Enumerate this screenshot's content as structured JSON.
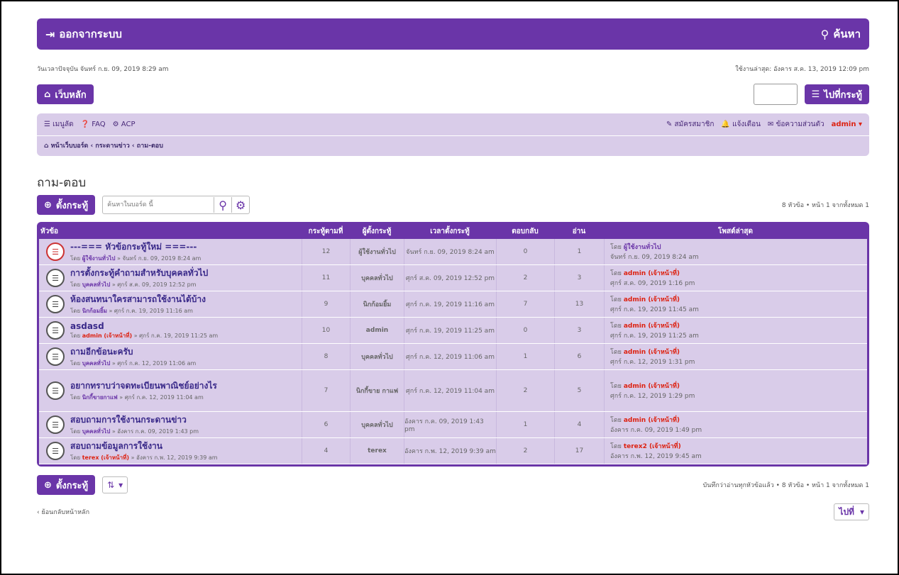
{
  "topbar": {
    "logout": "ออกจากระบบ",
    "search": "ค้นหา"
  },
  "timeline": {
    "current": "วันเวลาปัจจุบัน จันทร์ ก.ย. 09, 2019 8:29 am",
    "last_visit": "ใช้งานล่าสุด: อังคาร ส.ค. 13, 2019 12:09 pm"
  },
  "buttons": {
    "home": "เว็บหลัก",
    "goto_topic": "ไปที่กระทู้",
    "new_topic": "ตั้งกระทู้"
  },
  "navbar": {
    "left": [
      "เมนูลัด",
      "FAQ",
      "ACP"
    ],
    "right": [
      "สมัครสมาชิก",
      "แจ้งเตือน",
      "ข้อความส่วนตัว"
    ],
    "user": "admin",
    "breadcrumbs": [
      "หน้าเว็บบอร์ด",
      "กระดานข่าว",
      "ถาม-ตอบ"
    ]
  },
  "forum_title": "ถาม-ตอบ",
  "search_placeholder": "ค้นหาในบอร์ด นี้",
  "page_info_top": "8 หัวข้อ • หน้า 1 จากทั้งหมด 1",
  "columns": [
    "หัวข้อ",
    "กระทู้ตามที่",
    "ผู้ตั้งกระทู้",
    "เวลาตั้งกระทู้",
    "ตอบกลับ",
    "อ่าน",
    "โพสต์ล่าสุด"
  ],
  "rows": [
    {
      "title": "---=== หัวข้อกระทู้ใหม่ ===---",
      "by": "โดย",
      "author": "ผู้ใช้งานทั่วไป",
      "date": "» จันทร์ ก.ย. 09, 2019 8:24 am",
      "no": "12",
      "starter": "ผู้ใช้งานทั่วไป",
      "time": "จันทร์ ก.ย. 09, 2019 8:24 am",
      "replies": "0",
      "views": "1",
      "last_by": "ผู้ใช้งานทั่วไป",
      "last_date": "จันทร์ ก.ย. 09, 2019 8:24 am"
    },
    {
      "title": "การตั้งกระทู้คำถามสำหรับบุคคลทั่วไป",
      "by": "โดย",
      "author": "บุคคลทั่วไป",
      "date": "» ศุกร์ ส.ค. 09, 2019 12:52 pm",
      "no": "11",
      "starter": "บุคคลทั่วไป",
      "time": "ศุกร์ ส.ค. 09, 2019 12:52 pm",
      "replies": "2",
      "views": "3",
      "last_by": "admin (เจ้าหน้าที่)",
      "last_date": "ศุกร์ ส.ค. 09, 2019 1:16 pm"
    },
    {
      "title": "ห้องสนทนาใครสามารถใช้งานได้บ้าง",
      "by": "โดย",
      "author": "นิกก้อมยิ้ม",
      "date": "» ศุกร์ ก.ค. 19, 2019 11:16 am",
      "no": "9",
      "starter": "นิกก้อมยิ้ม",
      "time": "ศุกร์ ก.ค. 19, 2019 11:16 am",
      "replies": "7",
      "views": "13",
      "last_by": "admin (เจ้าหน้าที่)",
      "last_date": "ศุกร์ ก.ค. 19, 2019 11:45 am"
    },
    {
      "title": "asdasd",
      "by": "โดย",
      "author": "admin (เจ้าหน้าที่)",
      "date": "» ศุกร์ ก.ค. 19, 2019 11:25 am",
      "no": "10",
      "starter": "admin",
      "time": "ศุกร์ ก.ค. 19, 2019 11:25 am",
      "replies": "0",
      "views": "3",
      "last_by": "admin (เจ้าหน้าที่)",
      "last_date": "ศุกร์ ก.ค. 19, 2019 11:25 am"
    },
    {
      "title": "ถามอีกข้อนะครับ",
      "by": "โดย",
      "author": "บุคคลทั่วไป",
      "date": "» ศุกร์ ก.ค. 12, 2019 11:06 am",
      "no": "8",
      "starter": "บุคคลทั่วไป",
      "time": "ศุกร์ ก.ค. 12, 2019 11:06 am",
      "replies": "1",
      "views": "6",
      "last_by": "admin (เจ้าหน้าที่)",
      "last_date": "ศุกร์ ก.ค. 12, 2019 1:31 pm"
    },
    {
      "title": "อยากทราบว่าจดทะเบียนพาณิชย์อย่างไร",
      "by": "โดย",
      "author": "นิกกี้ขายกาแฟ",
      "date": "» ศุกร์ ก.ค. 12, 2019 11:04 am",
      "no": "7",
      "starter": "นิกกี้ขาย กาแฟ",
      "time": "ศุกร์ ก.ค. 12, 2019 11:04 am",
      "replies": "2",
      "views": "5",
      "last_by": "admin (เจ้าหน้าที่)",
      "last_date": "ศุกร์ ก.ค. 12, 2019 1:29 pm"
    },
    {
      "title": "สอบถามการใช้งานกระดานข่าว",
      "by": "โดย",
      "author": "บุคคลทั่วไป",
      "date": "» อังคาร ก.ค. 09, 2019 1:43 pm",
      "no": "6",
      "starter": "บุคคลทั่วไป",
      "time": "อังคาร ก.ค. 09, 2019 1:43 pm",
      "replies": "1",
      "views": "4",
      "last_by": "admin (เจ้าหน้าที่)",
      "last_date": "อังคาร ก.ค. 09, 2019 1:49 pm"
    },
    {
      "title": "สอบถามข้อมูลการใช้งาน",
      "by": "โดย",
      "author": "terex (เจ้าหน้าที่)",
      "date": "» อังคาร ก.พ. 12, 2019 9:39 am",
      "no": "4",
      "starter": "terex",
      "time": "อังคาร ก.พ. 12, 2019 9:39 am",
      "replies": "2",
      "views": "17",
      "last_by": "terex2 (เจ้าหน้าที่)",
      "last_date": "อังคาร ก.พ. 12, 2019 9:45 am"
    }
  ],
  "page_info_bottom": "บันทึกว่าอ่านทุกหัวข้อแล้ว • 8 หัวข้อ • หน้า 1 จากทั้งหมด 1",
  "back_link": "ย้อนกลับหน้าหลัก",
  "jump_label": "ไปที่"
}
